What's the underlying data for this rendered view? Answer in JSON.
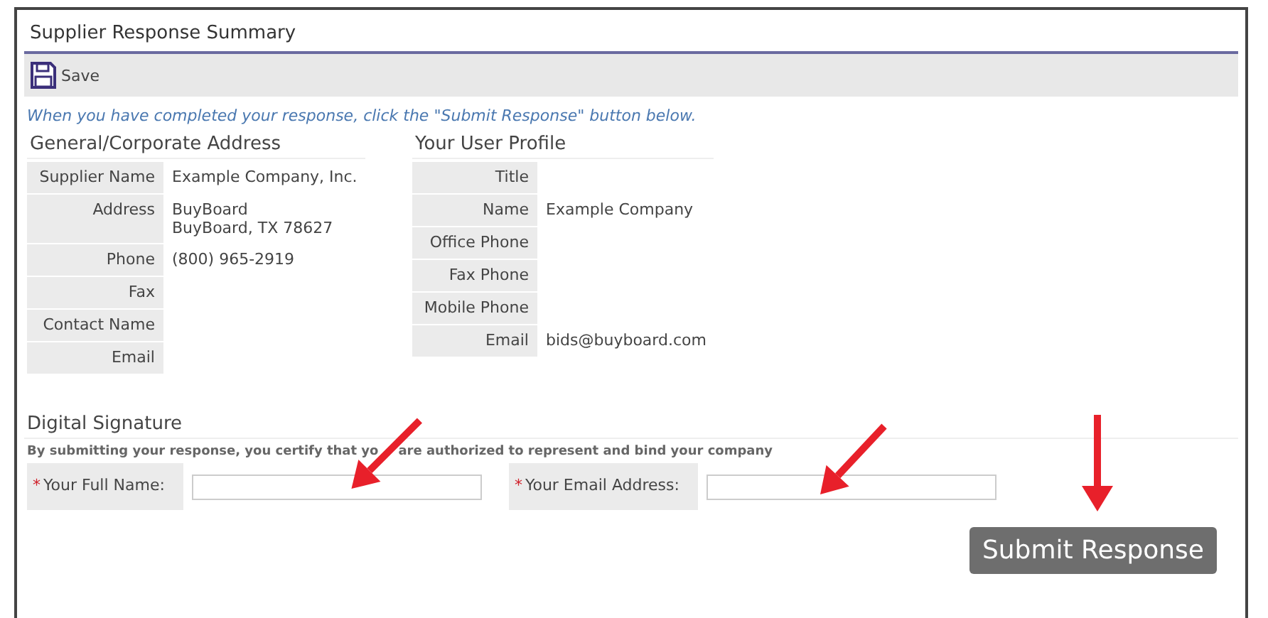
{
  "title": "Supplier Response Summary",
  "toolbar": {
    "save_label": "Save"
  },
  "instruction": "When you have completed your response, click the \"Submit Response\" button below.",
  "address": {
    "heading": "General/Corporate Address",
    "rows": [
      {
        "label": "Supplier Name",
        "value": "Example Company, Inc."
      },
      {
        "label": "Address",
        "value": "BuyBoard\nBuyBoard, TX 78627"
      },
      {
        "label": "Phone",
        "value": "(800) 965-2919"
      },
      {
        "label": "Fax"
      },
      {
        "label": "Contact Name"
      },
      {
        "label": "Email"
      }
    ]
  },
  "profile": {
    "heading": "Your User Profile",
    "rows": [
      {
        "label": "Title"
      },
      {
        "label": "Name",
        "value": "Example Company"
      },
      {
        "label": "Office Phone"
      },
      {
        "label": "Fax Phone"
      },
      {
        "label": "Mobile Phone"
      },
      {
        "label": "Email",
        "value": "bids@buyboard.com"
      }
    ]
  },
  "signature": {
    "heading": "Digital Signature",
    "disclaimer": [
      "By submitting your response, you certify that yo",
      "are authorized to represent and bind your company"
    ],
    "fields": [
      {
        "marker": "*",
        "label": "Your Full Name:"
      },
      {
        "marker": "*",
        "label": "Your Email Address:"
      }
    ]
  },
  "submit_button": "Submit Response"
}
